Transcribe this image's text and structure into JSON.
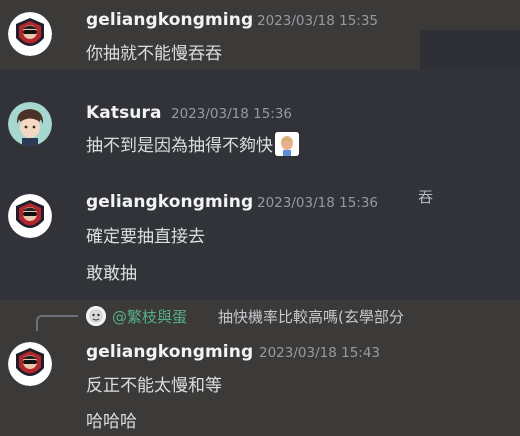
{
  "messages": [
    {
      "author": "geliangkongming",
      "timestamp": "2023/03/18 15:35",
      "lines": [
        "你抽就不能慢吞吞"
      ]
    },
    {
      "author": "Katsura",
      "timestamp": "2023/03/18 15:36",
      "lines": [
        "抽不到是因為抽得不夠快"
      ]
    },
    {
      "author": "geliangkongming",
      "timestamp": "2023/03/18 15:36",
      "lines": [
        "確定要抽直接去",
        "敢敢抽"
      ]
    },
    {
      "reply": {
        "mention": "@繁枝與蛋",
        "text": "抽快機率比較高嗎(玄學部分"
      },
      "author": "geliangkongming",
      "timestamp": "2023/03/18 15:43",
      "lines": [
        "反正不能太慢和等",
        "哈哈哈"
      ]
    }
  ],
  "stray_text": "吞",
  "colors": {
    "background": "#313338",
    "highlight_band": "#3b3a38",
    "author_name": "#f2f3f5",
    "timestamp": "#949ba4",
    "mention": "#57b08a"
  }
}
